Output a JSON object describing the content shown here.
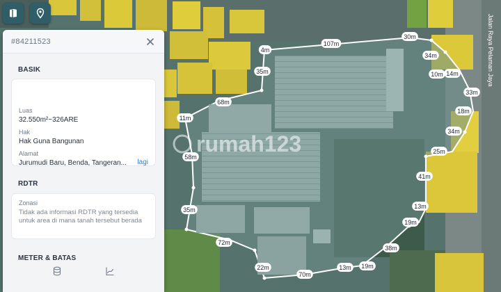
{
  "panel": {
    "id": "#84211523",
    "basik": {
      "title": "BASIK",
      "luas_label": "Luas",
      "luas_value": "32.550m²~326ARE",
      "hak_label": "Hak",
      "hak_value": "Hak Guna Bangunan",
      "alamat_label": "Alamat",
      "alamat_value": "Jurumudi Baru, Benda, Tangeran...",
      "more_link": "lagi"
    },
    "rdtr": {
      "title": "RDTR",
      "zonasi_label": "Zonasi",
      "zonasi_text": "Tidak ada informasi RDTR yang tersedia untuk area di mana tanah tersebut berada"
    },
    "meter": {
      "title": "METER & BATAS"
    }
  },
  "map": {
    "watermark": "rumah123",
    "road_label": "Jalan Raya Pelaman Jaya",
    "distances": [
      "107m",
      "30m",
      "34m",
      "14m",
      "10m",
      "33m",
      "18m",
      "34m",
      "25m",
      "41m",
      "13m",
      "19m",
      "38m",
      "19m",
      "13m",
      "70m",
      "22m",
      "72m",
      "35m",
      "58m",
      "11m",
      "68m",
      "35m",
      "4m"
    ],
    "colors": {
      "boundary": "#ffffff",
      "highlight": "#f2d52e",
      "accent": "#2a7de1"
    }
  }
}
